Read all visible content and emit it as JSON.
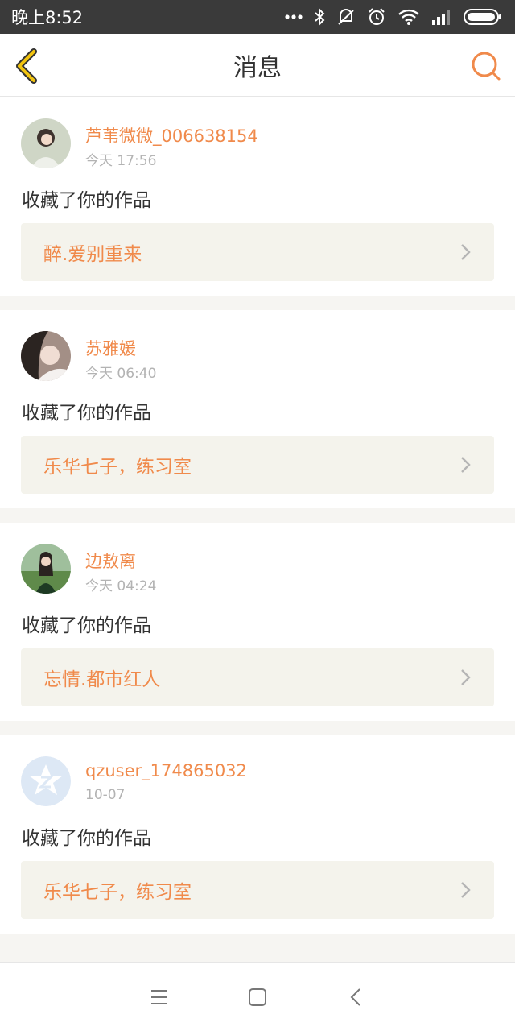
{
  "status_bar": {
    "time": "晚上8:52"
  },
  "header": {
    "title": "消息"
  },
  "colors": {
    "accent": "#f08a4b",
    "back": "#e8b600",
    "card_link_bg": "#f4f3ec"
  },
  "messages": [
    {
      "username": "芦苇微微_006638154",
      "time": "今天 17:56",
      "action": "收藏了你的作品",
      "work_title": "醉.爱别重来",
      "avatar_icon": "user-avatar-photo"
    },
    {
      "username": "苏雅媛",
      "time": "今天 06:40",
      "action": "收藏了你的作品",
      "work_title": "乐华七子，练习室",
      "avatar_icon": "user-avatar-photo"
    },
    {
      "username": "边敖离",
      "time": "今天 04:24",
      "action": "收藏了你的作品",
      "work_title": "忘情.都市红人",
      "avatar_icon": "user-avatar-photo"
    },
    {
      "username": "qzuser_174865032",
      "time": "10-07",
      "action": "收藏了你的作品",
      "work_title": "乐华七子，练习室",
      "avatar_icon": "qq-default-avatar-icon"
    }
  ],
  "nav_bar": {
    "menu_icon": "menu-icon",
    "home_icon": "home-square-icon",
    "back_icon": "back-arrow-icon"
  }
}
